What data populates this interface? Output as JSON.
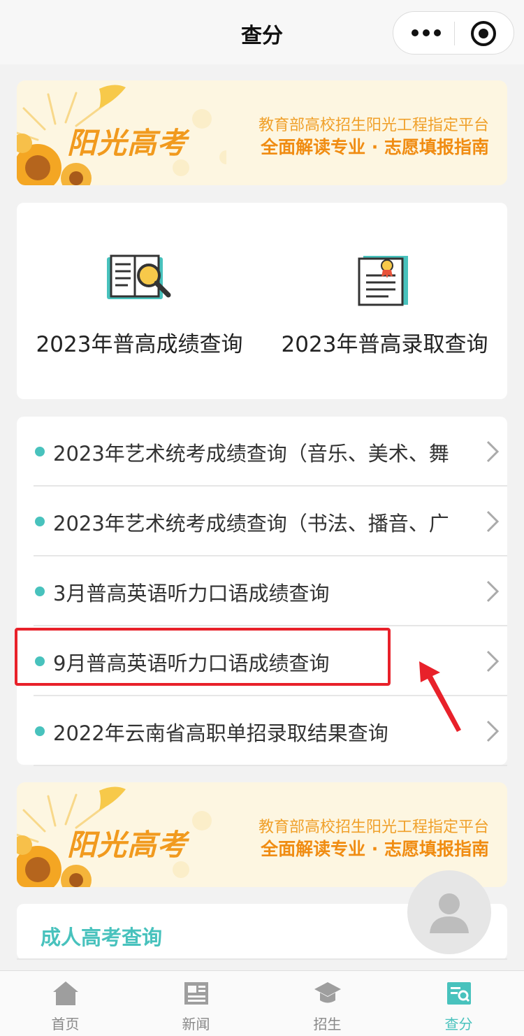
{
  "nav": {
    "title": "查分"
  },
  "banner": {
    "slogan": "阳光高考",
    "line1": "教育部高校招生阳光工程指定平台",
    "line2": "全面解读专业 · 志愿填报指南"
  },
  "quick": [
    {
      "label": "2023年普高成绩查询",
      "icon": "book-search-icon"
    },
    {
      "label": "2023年普高录取查询",
      "icon": "certificate-icon"
    }
  ],
  "list": [
    {
      "label": "2023年艺术统考成绩查询（音乐、美术、舞"
    },
    {
      "label": "2023年艺术统考成绩查询（书法、播音、广"
    },
    {
      "label": "3月普高英语听力口语成绩查询"
    },
    {
      "label": "9月普高英语听力口语成绩查询"
    },
    {
      "label": "2022年云南省高职单招录取结果查询"
    }
  ],
  "adult": {
    "title": "成人高考查询"
  },
  "tabs": [
    {
      "label": "首页",
      "icon": "home-icon"
    },
    {
      "label": "新闻",
      "icon": "news-icon"
    },
    {
      "label": "招生",
      "icon": "graduation-cap-icon"
    },
    {
      "label": "查分",
      "icon": "score-search-icon",
      "active": true
    }
  ],
  "colors": {
    "accent": "#48c2bd",
    "highlight": "#e8212a",
    "banner_text": "#f08c12"
  }
}
